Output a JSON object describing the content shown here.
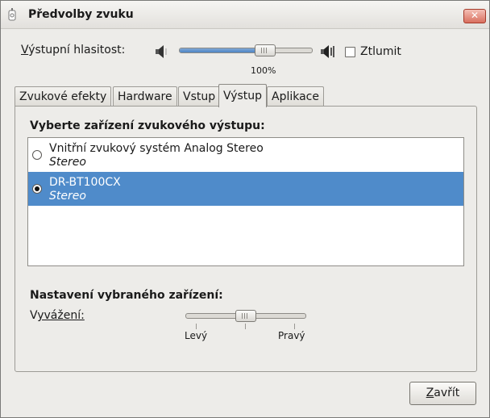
{
  "window": {
    "title": "Předvolby zvuku",
    "close_symbol": "✕"
  },
  "volume": {
    "label": "Výstupní hlasitost:",
    "label_mnemonic": "V",
    "label_rest": "ýstupní hlasitost:",
    "level_percent": 100,
    "value_text": "100%",
    "mute_label": "Ztlumit",
    "mute_checked": false
  },
  "tabs": [
    {
      "label": "Zvukové efekty",
      "active": false
    },
    {
      "label": "Hardware",
      "active": false
    },
    {
      "label": "Vstup",
      "active": false
    },
    {
      "label": "Výstup",
      "active": true
    },
    {
      "label": "Aplikace",
      "active": false
    }
  ],
  "output": {
    "heading": "Vyberte zařízení zvukového výstupu:",
    "devices": [
      {
        "name": "Vnitřní zvukový systém Analog Stereo",
        "profile": "Stereo",
        "selected": false
      },
      {
        "name": "DR-BT100CX",
        "profile": "Stereo",
        "selected": true
      }
    ]
  },
  "settings": {
    "heading": "Nastavení vybraného zařízení:",
    "balance_label": "Vyvážení:",
    "balance_mnemonic": "V",
    "balance_rest": "yvážení:",
    "balance_value": 0,
    "left_label": "Levý",
    "right_label": "Pravý"
  },
  "buttons": {
    "close_label": "Zavřít",
    "close_mnemonic": "Z",
    "close_rest": "avřít"
  },
  "colors": {
    "selection": "#4f8bca",
    "slider_fill": "#4d84c4",
    "close_button": "#d9705f"
  },
  "icons": [
    "app-icon",
    "speaker-low-icon",
    "speaker-high-icon",
    "close-icon"
  ]
}
